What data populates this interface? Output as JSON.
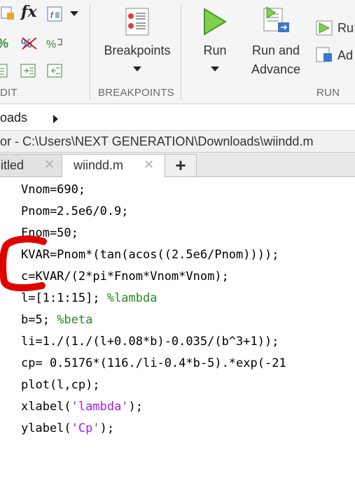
{
  "toolstrip": {
    "sections": {
      "edit_label": "DIT",
      "breakpoints_label": "BREAKPOINTS",
      "run_label": "RUN"
    },
    "fx_label": "fx",
    "breakpoints_button": "Breakpoints",
    "run_button": "Run",
    "run_and_advance_button": [
      "Run and",
      "Advance"
    ],
    "run_partial_top": "Ru",
    "run_partial_bottom": "Ad"
  },
  "breadcrumb": {
    "text": "oads"
  },
  "editor_title": "or - C:\\Users\\NEXT GENERATION\\Downloads\\wiindd.m",
  "tabs": [
    {
      "label": "itled",
      "active": false
    },
    {
      "label": "wiindd.m",
      "active": true
    }
  ],
  "tab_add_label": "+",
  "code": {
    "lines": [
      {
        "code": "Vnom=690;"
      },
      {
        "code": "Pnom=2.5e6/0.9;"
      },
      {
        "code": "Fnom=50;"
      },
      {
        "code": "KVAR=Pnom*(tan(acos((2.5e6/Pnom))));"
      },
      {
        "code": "c=KVAR/(2*pi*Fnom*Vnom*Vnom);"
      },
      {
        "code": "l=[1:1:15]; ",
        "comment": "%lambda"
      },
      {
        "code": "b=5; ",
        "comment": "%beta"
      },
      {
        "code": "li=1./(1./(l+0.08*b)-0.035/(b^3+1));"
      },
      {
        "code": "cp= 0.5176*(116./li-0.4*b-5).*exp(-21"
      },
      {
        "code": "plot(l,cp);"
      },
      {
        "code": "xlabel(",
        "string": "'lambda'",
        "tail": ");"
      },
      {
        "code": "ylabel(",
        "string": "'Cp'",
        "tail": ");"
      }
    ]
  },
  "colors": {
    "comment": "#228b22",
    "string": "#a020f0",
    "annotation": "#e00000"
  }
}
